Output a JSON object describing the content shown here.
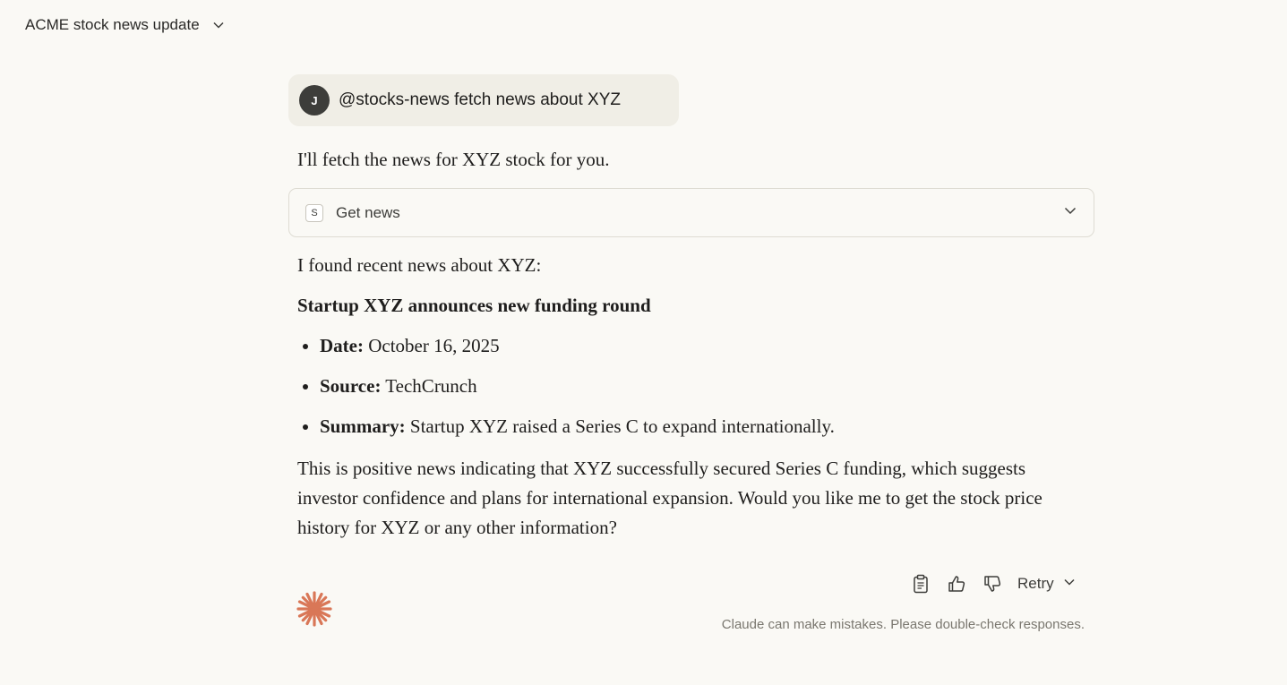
{
  "header": {
    "title": "ACME stock news update"
  },
  "user_message": {
    "avatar_initial": "J",
    "text": "@stocks-news fetch news about XYZ"
  },
  "assistant": {
    "intro": "I'll fetch the news for XYZ stock for you.",
    "tool": {
      "badge": "S",
      "label": "Get news"
    },
    "found": "I found recent news about XYZ:",
    "headline": "Startup XYZ announces new funding round",
    "items": [
      {
        "label": "Date:",
        "value": " October 16, 2025"
      },
      {
        "label": "Source:",
        "value": " TechCrunch"
      },
      {
        "label": "Summary:",
        "value": " Startup XYZ raised a Series C to expand internationally."
      }
    ],
    "closing": "This is positive news indicating that XYZ successfully secured Series C funding, which suggests investor confidence and plans for international expansion. Would you like me to get the stock price history for XYZ or any other information?"
  },
  "actions": {
    "retry_label": "Retry"
  },
  "footer": {
    "disclaimer": "Claude can make mistakes. Please double-check responses."
  },
  "icons": {
    "copy": "clipboard-icon",
    "like": "thumbs-up-icon",
    "dislike": "thumbs-down-icon",
    "logo": "claude-spark-icon"
  },
  "colors": {
    "background": "#faf9f5",
    "user_bubble": "#f0eee6",
    "accent": "#d97757"
  }
}
